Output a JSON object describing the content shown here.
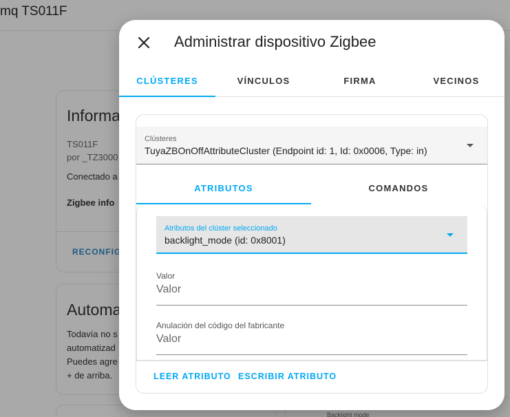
{
  "background": {
    "page_title": "mq TS011F",
    "card1": {
      "heading": "Informa",
      "model": "TS011F",
      "manufacturer": "por _TZ3000",
      "connected": "Conectado a",
      "zigbee_info": "Zigbee info",
      "action": "RECONFIG"
    },
    "card2": {
      "heading": "Automa",
      "lines": [
        "Todavía no s",
        "automatizad",
        "Puedes agre",
        "+ de arriba."
      ]
    },
    "card4_label": "Backlight mode"
  },
  "dialog": {
    "title": "Administrar dispositivo Zigbee",
    "tabs": [
      {
        "label": "CLÚSTERES",
        "active": true
      },
      {
        "label": "VÍNCULOS",
        "active": false
      },
      {
        "label": "FIRMA",
        "active": false
      },
      {
        "label": "VECINOS",
        "active": false
      }
    ],
    "cluster_select": {
      "label": "Clústeres",
      "value": "TuyaZBOnOffAttributeCluster (Endpoint id: 1, Id: 0x0006, Type: in)"
    },
    "subtabs": [
      {
        "label": "ATRIBUTOS",
        "active": true
      },
      {
        "label": "COMANDOS",
        "active": false
      }
    ],
    "attribute_select": {
      "label": "Atributos del clúster seleccionado",
      "value": "backlight_mode (id: 0x8001)"
    },
    "value_field": {
      "label": "Valor",
      "placeholder": "Valor"
    },
    "manufacturer_field": {
      "label": "Anulación del código del fabricante",
      "placeholder": "Valor"
    },
    "actions": {
      "read": "LEER ATRIBUTO",
      "write": "ESCRIBIR ATRIBUTO"
    }
  },
  "colors": {
    "accent": "#03a9f4",
    "scrim": "#a9a9a9"
  }
}
